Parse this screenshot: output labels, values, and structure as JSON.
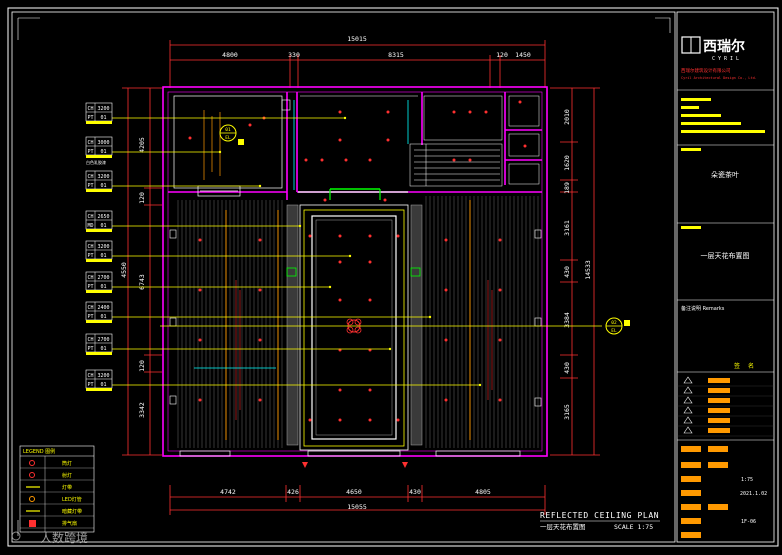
{
  "drawing": {
    "title_en": "REFLECTED CEILING PLAN",
    "title_cn": "一层天花布置图",
    "scale": "SCALE 1:75"
  },
  "dims": {
    "top_total": "15015",
    "top": [
      "4800",
      "330",
      "8315",
      "120",
      "1450"
    ],
    "bottom_total": "15055",
    "bottom": [
      "4742",
      "426",
      "4650",
      "430",
      "4805"
    ],
    "left": [
      "4205",
      "120",
      "4550",
      "6743",
      "120",
      "3342"
    ],
    "right_total": "14533",
    "right": [
      "2010",
      "1620",
      "189",
      "3161",
      "430",
      "3384",
      "430",
      "3165"
    ]
  },
  "level_tags": [
    {
      "code": "CH",
      "value": "3200",
      "mat": "PT",
      "no": "01",
      "note": ""
    },
    {
      "code": "CH",
      "value": "3000",
      "mat": "PT",
      "no": "01",
      "note": "白色乳胶漆"
    },
    {
      "code": "CH",
      "value": "3200",
      "mat": "PT",
      "no": "01",
      "note": ""
    },
    {
      "code": "CH",
      "value": "2650",
      "mat": "MD",
      "no": "01",
      "note": ""
    },
    {
      "code": "CH",
      "value": "3200",
      "mat": "PT",
      "no": "01",
      "note": ""
    },
    {
      "code": "CH",
      "value": "2700",
      "mat": "PT",
      "no": "01",
      "note": ""
    },
    {
      "code": "CH",
      "value": "2400",
      "mat": "PT",
      "no": "01",
      "note": ""
    },
    {
      "code": "CH",
      "value": "2700",
      "mat": "PT",
      "no": "01",
      "note": ""
    },
    {
      "code": "CH",
      "value": "3200",
      "mat": "PT",
      "no": "01",
      "note": ""
    }
  ],
  "section_marks": [
    {
      "label": "01",
      "sheet": "EL"
    },
    {
      "label": "02",
      "sheet": "EL"
    }
  ],
  "legend": {
    "title": "LEGEND 图例",
    "rows": [
      "筒灯",
      "射灯",
      "灯带",
      "LED灯管",
      "暗藏灯带",
      "排气扇"
    ]
  },
  "titleblock": {
    "logo_cn": "西瑞尔",
    "logo_en": "CYRIL",
    "company_cn": "西瑞尔建筑设计有限公司",
    "company_en": "Cyril Architectural Design Co., Ltd.",
    "project_name": "朵瓷茶叶",
    "drawing_name": "一层天花布置图",
    "remarks_label": "备注说明 Remarks",
    "sign_labels": [
      "签",
      "名"
    ],
    "scale": "1:75",
    "date": "2021.1.02",
    "sheet_no": "1F-06"
  },
  "watermark": "人数跨境",
  "colors": {
    "background": "#000000",
    "wall": "#ff00ff",
    "text": "#ffffff",
    "dim": "#ff3030",
    "yellow": "#ffff00",
    "cyan": "#00ffff",
    "orange": "#ff9900",
    "green": "#00ff00"
  }
}
